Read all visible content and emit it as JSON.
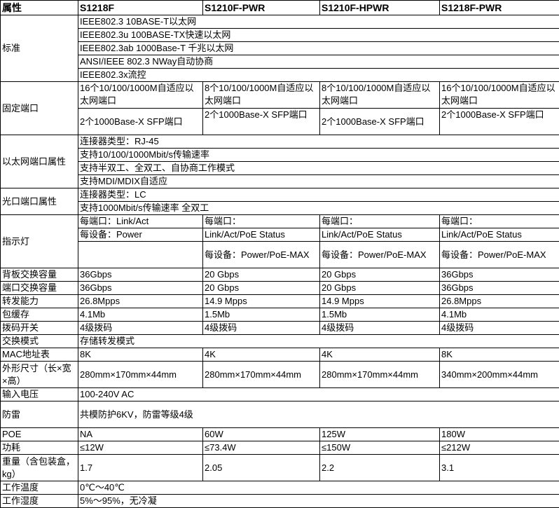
{
  "header": [
    "属性",
    "S1218F",
    "S1210F-PWR",
    "S1210F-HPWR",
    "S1218F-PWR"
  ],
  "standard": {
    "label": "标准",
    "items": [
      "IEEE802.3 10BASE-T以太网",
      "IEEE802.3u 100BASE-TX快速以太网",
      "IEEE802.3ab 1000Base-T 千兆以太网",
      "ANSI/IEEE 802.3 NWay自动协商",
      "IEEE802.3x流控"
    ]
  },
  "fixed_ports": {
    "label": "固定端口",
    "copper": [
      "16个10/100/1000M自适应以太网端口",
      "8个10/100/1000M自适应以太网端口",
      "8个10/100/1000M自适应以太网端口",
      "16个10/100/1000M自适应以太网端口"
    ],
    "sfp": [
      "2个1000Base-X SFP端口",
      "2个1000Base-X SFP端口",
      "2个1000Base-X SFP端口",
      "2个1000Base-X SFP端口"
    ]
  },
  "ethernet": {
    "label": "以太网端口属性",
    "items": [
      "连接器类型：RJ-45",
      "支持10/100/1000Mbit/s传输速率",
      "支持半双工、全双工、自协商工作模式",
      "支持MDI/MDIX自适应"
    ]
  },
  "optical": {
    "label": "光口端口属性",
    "items": [
      "连接器类型：LC",
      "支持1000Mbit/s传输速率 全双工"
    ]
  },
  "indicator": {
    "label": "指示灯",
    "s1218f": [
      "每端口：Link/Act",
      "每设备：Power"
    ],
    "poe": [
      "每端口：",
      "Link/Act/PoE Status",
      "每设备：Power/PoE-MAX"
    ]
  },
  "rows": [
    {
      "label": "背板交换容量",
      "values": [
        "36Gbps",
        "20 Gbps",
        "20 Gbps",
        "36Gbps"
      ]
    },
    {
      "label": "端口交换容量",
      "values": [
        "36Gbps",
        "20 Gbps",
        "20 Gbps",
        "36Gbps"
      ]
    },
    {
      "label": "转发能力",
      "values": [
        "26.8Mpps",
        "14.9 Mpps",
        "14.9 Mpps",
        "26.8Mpps"
      ]
    },
    {
      "label": "包缓存",
      "values": [
        "4.1Mb",
        "1.5Mb",
        "1.5Mb",
        "4.1Mb"
      ]
    },
    {
      "label": "拨码开关",
      "values": [
        "4级拨码",
        "4级拨码",
        "4级拨码",
        "4级拨码"
      ]
    }
  ],
  "switch_mode": {
    "label": "交换模式",
    "value": "存储转发模式"
  },
  "mac": {
    "label": "MAC地址表",
    "values": [
      "8K",
      "4K",
      "4K",
      "8K"
    ]
  },
  "dimensions": {
    "label": "外形尺寸（长×宽×高）",
    "values": [
      "280mm×170mm×44mm",
      "280mm×170mm×44mm",
      "280mm×170mm×44mm",
      "340mm×200mm×44mm"
    ]
  },
  "voltage": {
    "label": "输入电压",
    "value": "100-240V AC"
  },
  "lightning": {
    "label": "防雷",
    "value": "共模防护6KV，防雷等级4级"
  },
  "poe": {
    "label": "POE",
    "values": [
      "NA",
      "60W",
      "125W",
      "180W"
    ]
  },
  "power": {
    "label": "功耗",
    "values": [
      "≤12W",
      "≤73.4W",
      "≤150W",
      "≤212W"
    ]
  },
  "weight": {
    "label": "重量（含包装盒，kg）",
    "values": [
      "1.7",
      "2.05",
      "2.2",
      "3.1"
    ]
  },
  "temp": {
    "label": "工作温度",
    "value": "0℃～40℃"
  },
  "humidity": {
    "label": "工作湿度",
    "value": "5%～95%，无冷凝"
  }
}
